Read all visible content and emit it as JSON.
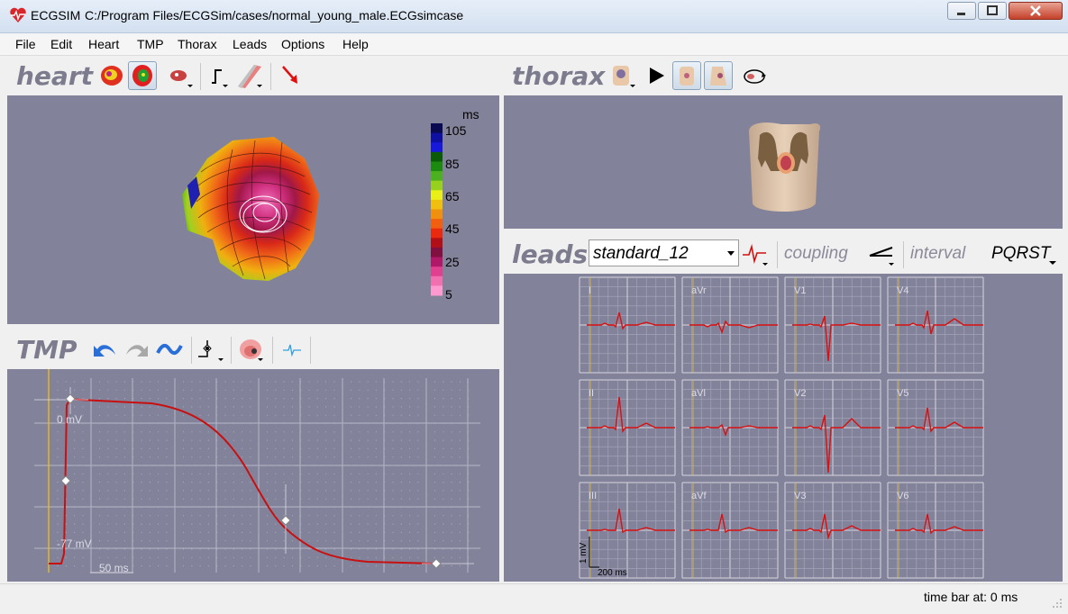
{
  "window": {
    "app_name": "ECGSIM",
    "path": "C:/Program Files/ECGSim/cases/normal_young_male.ECGsimcase"
  },
  "menu": [
    "File",
    "Edit",
    "Heart",
    "TMP",
    "Thorax",
    "Leads",
    "Options",
    "Help"
  ],
  "heart": {
    "label": "heart",
    "colorbar": {
      "unit": "ms",
      "ticks": [
        "105",
        "85",
        "65",
        "45",
        "25",
        "5"
      ],
      "colors": [
        "#0a0a50",
        "#1010a0",
        "#1818d8",
        "#0a5a0a",
        "#1c8a10",
        "#4cb020",
        "#98d020",
        "#e8f018",
        "#f0c010",
        "#f09010",
        "#f06010",
        "#e82a10",
        "#b01018",
        "#801040",
        "#b01868",
        "#e04090",
        "#f070b0",
        "#ff9ad0"
      ]
    }
  },
  "thorax": {
    "label": "thorax"
  },
  "tmp": {
    "label": "TMP",
    "zero_label": "0 mV",
    "rest_label": "-77 mV",
    "scale_label": "50 ms"
  },
  "leads": {
    "label": "leads",
    "selected_set": "standard_12",
    "coupling_label": "coupling",
    "interval_label": "interval",
    "interval_value": "PQRST",
    "lead_names": [
      "I",
      "aVr",
      "V1",
      "V4",
      "II",
      "aVl",
      "V2",
      "V5",
      "III",
      "aVf",
      "V3",
      "V6"
    ],
    "scale_mv": "1 mV",
    "scale_ms": "200 ms"
  },
  "status": {
    "time_bar": "time bar at: 0 ms"
  }
}
